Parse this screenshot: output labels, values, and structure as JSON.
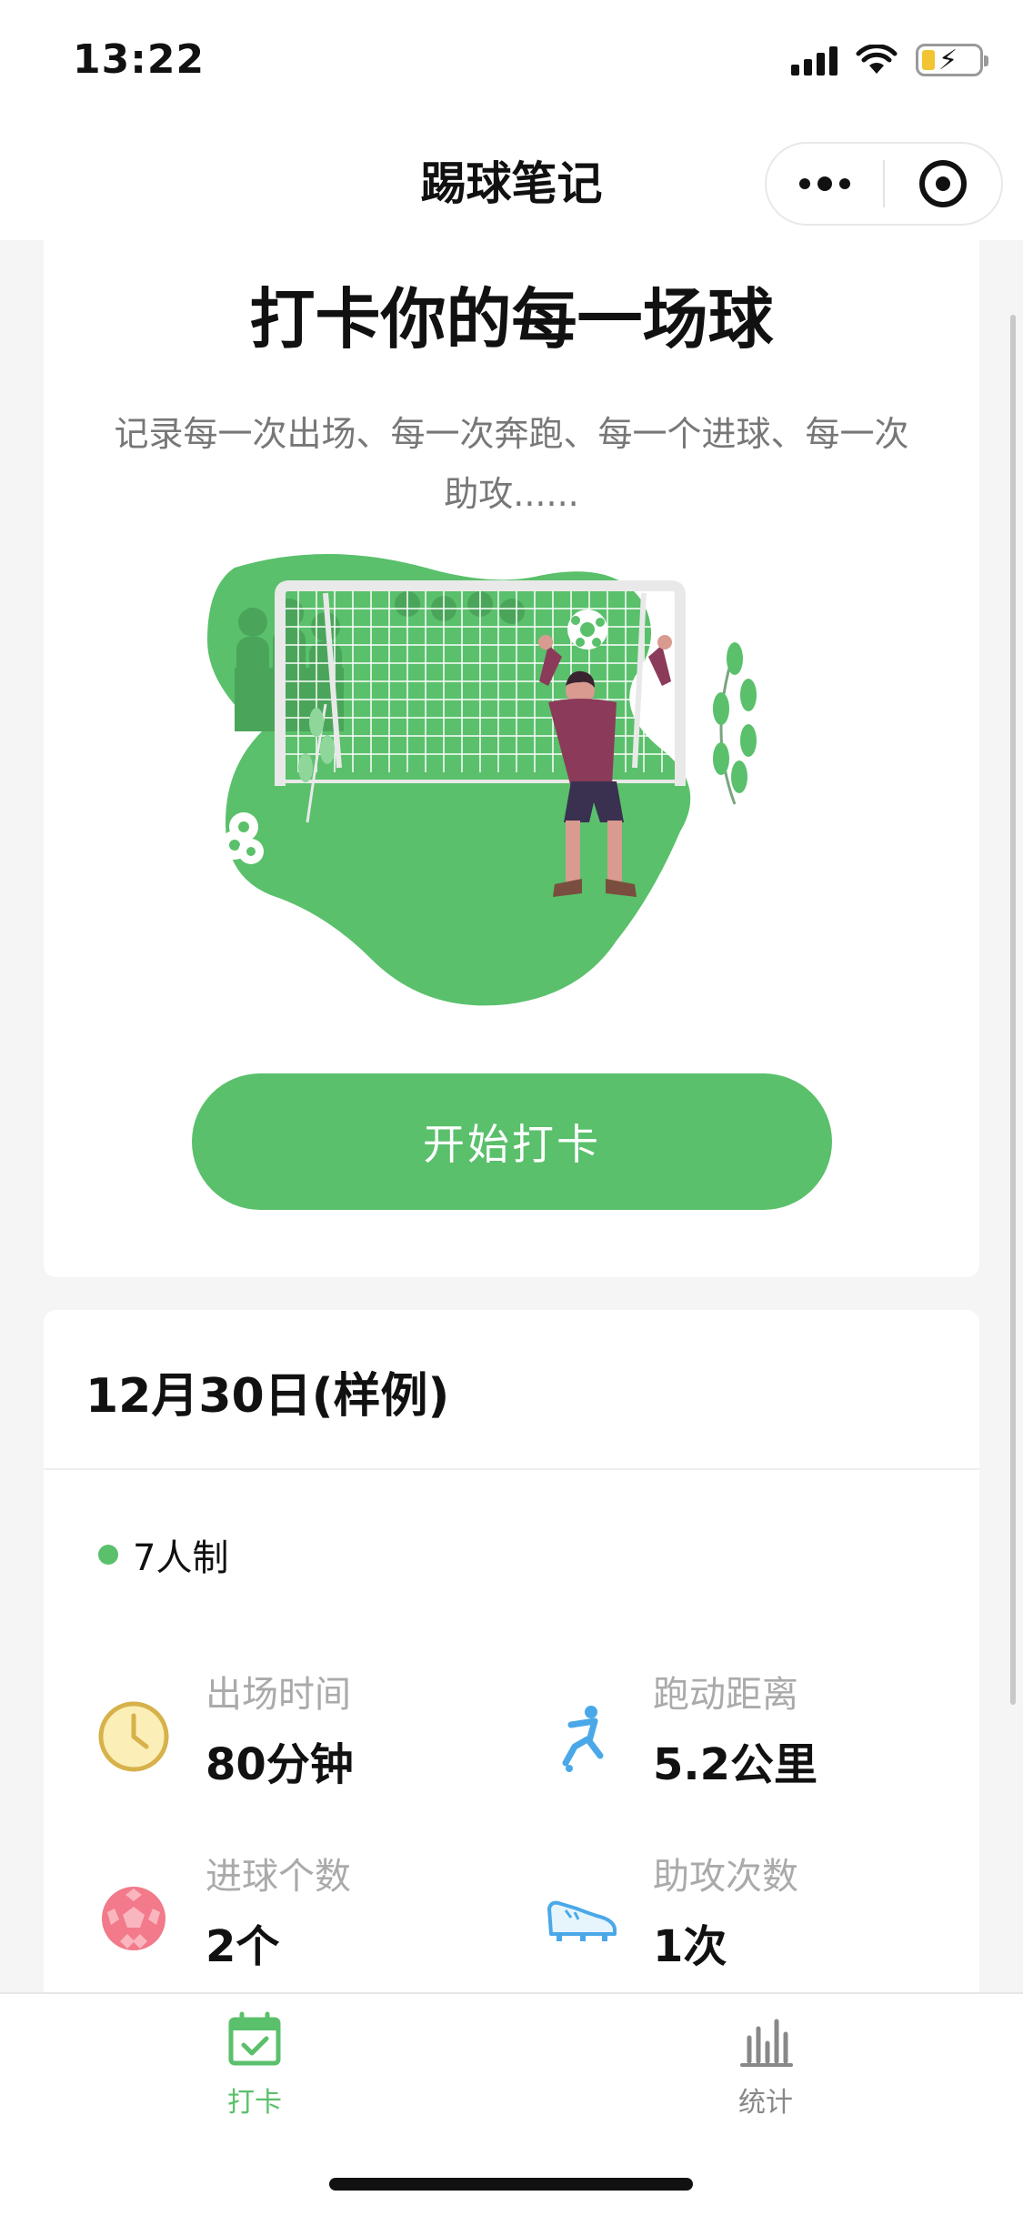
{
  "status_bar": {
    "time": "13:22"
  },
  "nav": {
    "title": "踢球笔记"
  },
  "hero": {
    "title": "打卡你的每一场球",
    "subtitle": "记录每一次出场、每一次奔跑、每一个进球、每一次助攻......",
    "start_button": "开始打卡"
  },
  "record": {
    "date": "12月30日(样例)",
    "format": "7人制",
    "stats": [
      {
        "label": "出场时间",
        "value": "80分钟",
        "icon": "clock-icon"
      },
      {
        "label": "跑动距离",
        "value": "5.2公里",
        "icon": "runner-icon"
      },
      {
        "label": "进球个数",
        "value": "2个",
        "icon": "football-icon"
      },
      {
        "label": "助攻次数",
        "value": "1次",
        "icon": "boot-icon"
      }
    ]
  },
  "tabbar": {
    "items": [
      {
        "label": "打卡",
        "icon": "calendar-check-icon",
        "active": true
      },
      {
        "label": "统计",
        "icon": "bar-chart-icon",
        "active": false
      }
    ]
  },
  "colors": {
    "accent": "#5ac06b",
    "muted": "#aaaaaa"
  }
}
